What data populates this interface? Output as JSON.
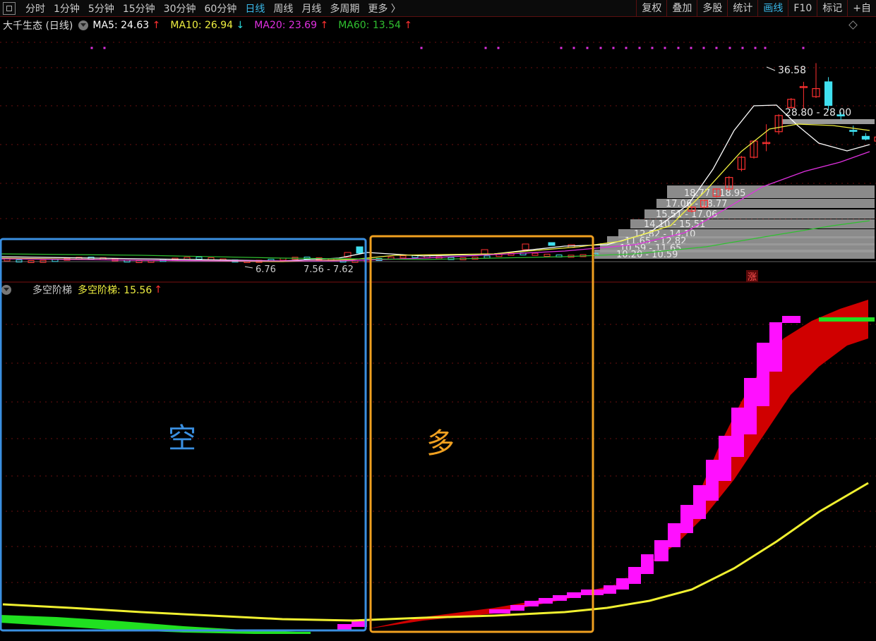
{
  "toolbar": {
    "periods": [
      "分时",
      "1分钟",
      "5分钟",
      "15分钟",
      "30分钟",
      "60分钟",
      "日线",
      "周线",
      "月线",
      "多周期",
      "更多 〉"
    ],
    "active_period": "日线",
    "right_buttons": [
      "复权",
      "叠加",
      "多股",
      "统计",
      "画线",
      "F10",
      "标记",
      "+自"
    ],
    "active_right": "画线"
  },
  "legend": {
    "title": "大千生态 (日线)",
    "ma5": "MA5: 24.63",
    "ma5_dir": "↑",
    "ma10": "MA10: 26.94",
    "ma10_dir": "↓",
    "ma20": "MA20: 23.69",
    "ma20_dir": "↑",
    "ma60": "MA60: 13.54",
    "ma60_dir": "↑"
  },
  "indicator_legend": {
    "name": "多空阶梯",
    "value_label": "多空阶梯: 15.56",
    "dir": "↑"
  },
  "annotations": {
    "bear_label": "空",
    "bull_label": "多",
    "zhang": "涨"
  },
  "colors": {
    "ma5": "#ffffff",
    "ma10": "#f0f040",
    "ma20": "#e030e0",
    "ma60": "#30c030",
    "up": "#ff3030",
    "down": "#40e0f0",
    "bear_box": "#3a8fe0",
    "bull_box": "#f0a020",
    "step_up": "#ff10ff",
    "step_down": "#20e020",
    "band": "#d00000",
    "indicator_line": "#f0f030"
  },
  "chart_data": {
    "type": "candlestick",
    "price_labels": {
      "high": "36.58",
      "low": "6.76",
      "low_range": "7.56 - 7.62",
      "resistance": "28.80 - 28.00"
    },
    "volume_profile": [
      "18.77 - 18.95",
      "17.06 - 18.77",
      "15.51 - 17.06",
      "14.10 - 15.51",
      "12.82 - 14.10",
      "11.65 - 12.82",
      "10.59 - 11.65",
      "10.20 - 10.59"
    ],
    "late_candles": [
      {
        "o": 14.6,
        "c": 15.2,
        "h": 15.3,
        "l": 14.4
      },
      {
        "o": 15.2,
        "c": 16.2,
        "h": 16.3,
        "l": 15.0
      },
      {
        "o": 16.8,
        "c": 17.9,
        "h": 18.0,
        "l": 16.6
      },
      {
        "o": 17.9,
        "c": 19.6,
        "h": 19.8,
        "l": 17.6
      },
      {
        "o": 20.8,
        "c": 22.6,
        "h": 22.8,
        "l": 20.5
      },
      {
        "o": 22.6,
        "c": 25.0,
        "h": 25.1,
        "l": 22.4
      },
      {
        "o": 24.7,
        "c": 24.8,
        "h": 27.5,
        "l": 23.5
      },
      {
        "o": 26.4,
        "c": 28.8,
        "h": 29.0,
        "l": 26.0
      },
      {
        "o": 30.0,
        "c": 31.2,
        "h": 31.4,
        "l": 29.8
      },
      {
        "o": 33.0,
        "c": 33.1,
        "h": 33.8,
        "l": 29.8
      },
      {
        "o": 31.6,
        "c": 32.8,
        "h": 36.58,
        "l": 31.4
      },
      {
        "o": 33.8,
        "c": 30.3,
        "h": 34.5,
        "l": 29.6
      },
      {
        "o": 28.9,
        "c": 28.8,
        "h": 29.3,
        "l": 28.1
      },
      {
        "o": 26.6,
        "c": 26.5,
        "h": 27.3,
        "l": 25.8
      },
      {
        "o": 25.7,
        "c": 25.3,
        "h": 26.2,
        "l": 25.1
      },
      {
        "o": 25.0,
        "c": 25.6,
        "h": 25.9,
        "l": 24.9
      },
      {
        "o": 25.3,
        "c": 26.0,
        "h": 26.2,
        "l": 25.2
      },
      {
        "o": 25.7,
        "c": 26.6,
        "h": 26.8,
        "l": 25.6
      },
      {
        "o": 26.4,
        "c": 28.5,
        "h": 29.0,
        "l": 26.2
      }
    ]
  }
}
